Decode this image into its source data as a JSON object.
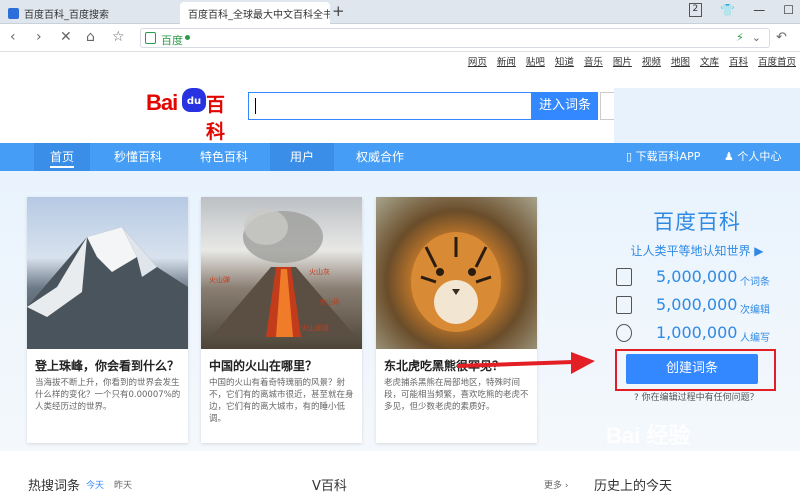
{
  "browser": {
    "tabs": [
      {
        "title": "百度百科_百度搜索"
      },
      {
        "title": "百度百科_全球最大中文百科全书"
      }
    ],
    "new_tab": "+",
    "tab_count": "2",
    "address": {
      "site_label": "百度"
    }
  },
  "top_nav": [
    "网页",
    "新闻",
    "贴吧",
    "知道",
    "音乐",
    "图片",
    "视频",
    "地图",
    "文库",
    "百科",
    "百度首页"
  ],
  "logo": {
    "bai": "Bai",
    "du": "du",
    "baike": "百科"
  },
  "search": {
    "button": "进入词条"
  },
  "main_nav": {
    "items": [
      "首页",
      "秒懂百科",
      "特色百科",
      "用户",
      "权威合作"
    ],
    "app": "下载百科APP",
    "user_center": "个人中心"
  },
  "cards": [
    {
      "title": "登上珠峰，你会看到什么？",
      "desc": "当海拔不断上升，你看到的世界会发生什么样的变化？一个只有0.00007%的人类经历过的世界。"
    },
    {
      "title": "中国的火山在哪里？",
      "desc": "中国的火山有着奇特瑰丽的风景？射不，它们有的离城市很近，甚至就在身边，它们有的离大城市，有的睡小低调。"
    },
    {
      "title": "东北虎吃黑熊很罕见？",
      "desc": "老虎捕杀黑熊在局部地区，特殊时间段，可能相当频繁，喜欢吃熊的老虎不多见，但少数老虎的素质好。"
    }
  ],
  "volcano_labels": [
    "火山弹",
    "火山灰",
    "火山砾",
    "火山通道"
  ],
  "brand": {
    "title": "百度百科",
    "slogan": "让人类平等地认知世界"
  },
  "stats": [
    {
      "value": "5,000,000",
      "unit": "个词条",
      "icon": "document-icon"
    },
    {
      "value": "5,000,000",
      "unit": "次编辑",
      "icon": "edit-icon"
    },
    {
      "value": "1,000,000",
      "unit": "人编写",
      "icon": "people-icon"
    }
  ],
  "create_button": "创建词条",
  "edit_link": "你在编辑过程中有任何问题？",
  "bottom": {
    "hot": "热搜词条",
    "today": "今天",
    "yesterday": "昨天",
    "v": "V百科",
    "more": "更多",
    "history": "历史上的今天"
  },
  "watermark": "Bai 经验",
  "colors": {
    "accent": "#3388ff",
    "nav": "#459df5",
    "brand_red": "#e10601",
    "highlight": "#e31e24"
  }
}
